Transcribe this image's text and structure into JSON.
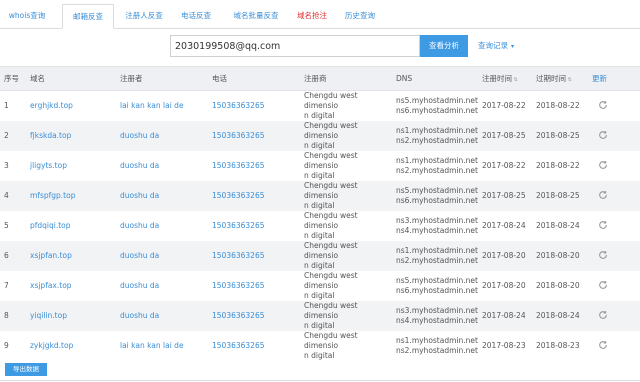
{
  "tabs": [
    {
      "label": "whois查询",
      "active": false,
      "color": "#3a8ed6"
    },
    {
      "label": "邮箱反查",
      "active": true,
      "color": "#3a8ed6"
    },
    {
      "label": "注册人反查",
      "active": false,
      "color": "#3a8ed6"
    },
    {
      "label": "电话反查",
      "active": false,
      "color": "#3a8ed6"
    },
    {
      "label": "域名批量反查",
      "active": false,
      "color": "#3a8ed6"
    },
    {
      "label": "域名抢注",
      "active": false,
      "color": "#e03030"
    },
    {
      "label": "历史查询",
      "active": false,
      "color": "#3a8ed6"
    }
  ],
  "search": {
    "value": "2030199508@qq.com",
    "button_label": "查看分析",
    "history_label": "查询记录",
    "history_icon": "chevron-down-icon"
  },
  "table": {
    "headers": {
      "index": "序号",
      "domain": "域名",
      "registrant": "注册者",
      "phone": "电话",
      "registrar": "注册商",
      "dns": "DNS",
      "reg_date": "注册时间",
      "exp_date": "过期时间",
      "refresh": "更新"
    },
    "sort_icon": "sort-arrows-icon",
    "refresh_icon": "refresh-icon",
    "rows": [
      {
        "index": "1",
        "domain": "erghjkd.top",
        "registrant": "lai kan kan lai de",
        "phone": "15036363265",
        "registrar_1": "Chengdu west dimensio",
        "registrar_2": "n digital",
        "dns_1": "ns5.myhostadmin.net",
        "dns_2": "ns6.myhostadmin.net",
        "reg_date": "2017-08-22",
        "exp_date": "2018-08-22"
      },
      {
        "index": "2",
        "domain": "fjkskda.top",
        "registrant": "duoshu da",
        "phone": "15036363265",
        "registrar_1": "Chengdu west dimensio",
        "registrar_2": "n digital",
        "dns_1": "ns1.myhostadmin.net",
        "dns_2": "ns2.myhostadmin.net",
        "reg_date": "2017-08-25",
        "exp_date": "2018-08-25"
      },
      {
        "index": "3",
        "domain": "jligyts.top",
        "registrant": "duoshu da",
        "phone": "15036363265",
        "registrar_1": "Chengdu west dimensio",
        "registrar_2": "n digital",
        "dns_1": "ns1.myhostadmin.net",
        "dns_2": "ns2.myhostadmin.net",
        "reg_date": "2017-08-22",
        "exp_date": "2018-08-22"
      },
      {
        "index": "4",
        "domain": "mfspfgp.top",
        "registrant": "duoshu da",
        "phone": "15036363265",
        "registrar_1": "Chengdu west dimensio",
        "registrar_2": "n digital",
        "dns_1": "ns5.myhostadmin.net",
        "dns_2": "ns6.myhostadmin.net",
        "reg_date": "2017-08-25",
        "exp_date": "2018-08-25"
      },
      {
        "index": "5",
        "domain": "pfdqiqi.top",
        "registrant": "duoshu da",
        "phone": "15036363265",
        "registrar_1": "Chengdu west dimensio",
        "registrar_2": "n digital",
        "dns_1": "ns3.myhostadmin.net",
        "dns_2": "ns4.myhostadmin.net",
        "reg_date": "2017-08-24",
        "exp_date": "2018-08-24"
      },
      {
        "index": "6",
        "domain": "xsjpfan.top",
        "registrant": "duoshu da",
        "phone": "15036363265",
        "registrar_1": "Chengdu west dimensio",
        "registrar_2": "n digital",
        "dns_1": "ns1.myhostadmin.net",
        "dns_2": "ns2.myhostadmin.net",
        "reg_date": "2017-08-20",
        "exp_date": "2018-08-20"
      },
      {
        "index": "7",
        "domain": "xsjpfax.top",
        "registrant": "duoshu da",
        "phone": "15036363265",
        "registrar_1": "Chengdu west dimensio",
        "registrar_2": "n digital",
        "dns_1": "ns5.myhostadmin.net",
        "dns_2": "ns6.myhostadmin.net",
        "reg_date": "2017-08-20",
        "exp_date": "2018-08-20"
      },
      {
        "index": "8",
        "domain": "yiqilin.top",
        "registrant": "duoshu da",
        "phone": "15036363265",
        "registrar_1": "Chengdu west dimensio",
        "registrar_2": "n digital",
        "dns_1": "ns3.myhostadmin.net",
        "dns_2": "ns4.myhostadmin.net",
        "reg_date": "2017-08-24",
        "exp_date": "2018-08-24"
      },
      {
        "index": "9",
        "domain": "zykjgkd.top",
        "registrant": "lai kan kan lai de",
        "phone": "15036363265",
        "registrar_1": "Chengdu west dimensio",
        "registrar_2": "n digital",
        "dns_1": "ns1.myhostadmin.net",
        "dns_2": "ns2.myhostadmin.net",
        "reg_date": "2017-08-23",
        "exp_date": "2018-08-23"
      }
    ]
  },
  "export": {
    "label": "导出数据"
  },
  "colors": {
    "accent": "#3f9ae4",
    "link": "#3a8ed6",
    "warning": "#e03030",
    "header_bg": "#eef0f4",
    "stripe_bg": "#f2f3f5"
  }
}
